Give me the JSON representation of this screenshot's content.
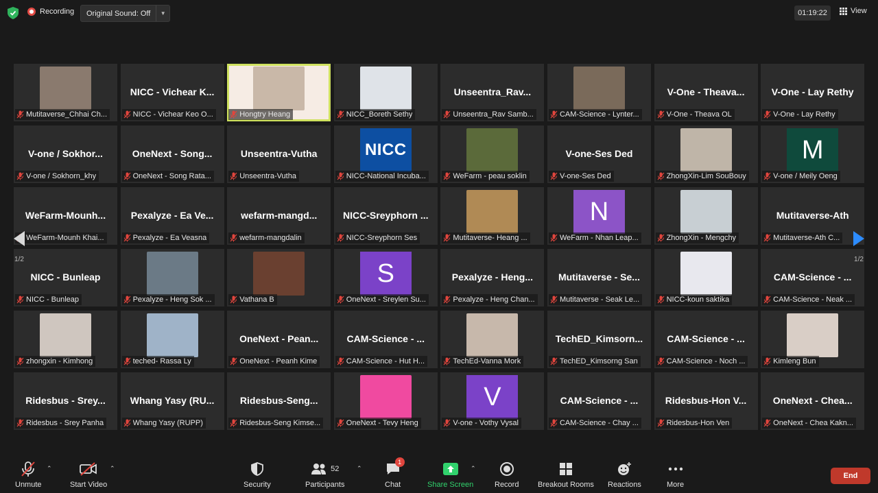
{
  "topbar": {
    "recording_label": "Recording",
    "sound_label": "Original Sound: Off",
    "timer": "01:19:22",
    "view_label": "View"
  },
  "pager": {
    "left": "1/2",
    "right": "1/2"
  },
  "tiles": [
    {
      "type": "photo",
      "bg": "#8a7a6e",
      "label": "Mutitaverse_Chhai Ch..."
    },
    {
      "type": "text",
      "name": "NICC - Vichear K...",
      "label": "NICC - Vichear Keo O..."
    },
    {
      "type": "active",
      "bg": "#c9b8a8",
      "label": "Hongtry Heang"
    },
    {
      "type": "photo",
      "bg": "#dfe3e8",
      "label": "NICC_Boreth Sethy"
    },
    {
      "type": "text",
      "name": "Unseentra_Rav...",
      "label": "Unseentra_Rav Samb..."
    },
    {
      "type": "photo",
      "bg": "#7a6a5a",
      "label": "CAM-Science - Lynter..."
    },
    {
      "type": "text",
      "name": "V-One - Theava...",
      "label": "V-One - Theava OL"
    },
    {
      "type": "text",
      "name": "V-One - Lay Rethy",
      "label": "V-One - Lay Rethy"
    },
    {
      "type": "text",
      "name": "V-one / Sokhor...",
      "label": "V-one / Sokhorn_khy"
    },
    {
      "type": "text",
      "name": "OneNext - Song...",
      "label": "OneNext - Song Rata..."
    },
    {
      "type": "text",
      "name": "Unseentra-Vutha",
      "label": "Unseentra-Vutha"
    },
    {
      "type": "nicc",
      "logo": "NICC",
      "label": "NICC-National Incuba..."
    },
    {
      "type": "photo",
      "bg": "#5b6a3a",
      "label": "WeFarm - peau soklin"
    },
    {
      "type": "text",
      "name": "V-one-Ses Ded",
      "label": "V-one-Ses Ded"
    },
    {
      "type": "photo",
      "bg": "#bfb5a8",
      "label": "ZhongXin-Lim SouBouy"
    },
    {
      "type": "letter",
      "letter": "M",
      "bg": "#0f4a3c",
      "label": "V-one / Meily Oeng"
    },
    {
      "type": "text",
      "name": "WeFarm-Mounh...",
      "label": "WeFarm-Mounh Khai..."
    },
    {
      "type": "text",
      "name": "Pexalyze - Ea Ve...",
      "label": "Pexalyze - Ea Veasna"
    },
    {
      "type": "text",
      "name": "wefarm-mangd...",
      "label": "wefarm-mangdalin"
    },
    {
      "type": "text",
      "name": "NICC-Sreyphorn ...",
      "label": "NICC-Sreyphorn Ses"
    },
    {
      "type": "photo",
      "bg": "#b08a55",
      "label": "Mutitaverse- Heang ..."
    },
    {
      "type": "letter",
      "letter": "N",
      "bg": "#8c54c7",
      "label": "WeFarm - Nhan Leap..."
    },
    {
      "type": "photo",
      "bg": "#c8cfd3",
      "label": "ZhongXin - Mengchy"
    },
    {
      "type": "text",
      "name": "Mutitaverse-Ath",
      "label": "Mutitaverse-Ath C..."
    },
    {
      "type": "text",
      "name": "NICC - Bunleap",
      "label": "NICC - Bunleap"
    },
    {
      "type": "photo",
      "bg": "#6b7a86",
      "label": "Pexalyze - Heng Sok ..."
    },
    {
      "type": "photo",
      "bg": "#6a4030",
      "label": "Vathana B"
    },
    {
      "type": "letter",
      "letter": "S",
      "bg": "#7b42c8",
      "label": "OneNext - Sreylen Su..."
    },
    {
      "type": "text",
      "name": "Pexalyze - Heng...",
      "label": "Pexalyze - Heng Chan..."
    },
    {
      "type": "text",
      "name": "Mutitaverse - Se...",
      "label": "Mutitaverse - Seak Le..."
    },
    {
      "type": "photo",
      "bg": "#e8e8ee",
      "label": "NICC-koun saktika"
    },
    {
      "type": "text",
      "name": "CAM-Science - ...",
      "label": "CAM-Science - Neak ..."
    },
    {
      "type": "photo",
      "bg": "#cfc6bf",
      "label": "zhongxin - Kimhong"
    },
    {
      "type": "photo",
      "bg": "#9fb3c8",
      "label": "teched- Rassa Ly"
    },
    {
      "type": "text",
      "name": "OneNext - Pean...",
      "label": "OneNext - Peanh Kime"
    },
    {
      "type": "text",
      "name": "CAM-Science - ...",
      "label": "CAM-Science - Hut H..."
    },
    {
      "type": "photo",
      "bg": "#c7b8ab",
      "label": "TechEd-Vanna Mork"
    },
    {
      "type": "text",
      "name": "TechED_Kimsorn...",
      "label": "TechED_Kimsorng San"
    },
    {
      "type": "text",
      "name": "CAM-Science - ...",
      "label": "CAM-Science - Noch ..."
    },
    {
      "type": "photo",
      "bg": "#d9cec6",
      "label": "Kimleng Bun"
    },
    {
      "type": "text",
      "name": "Ridesbus - Srey...",
      "label": "Ridesbus - Srey Panha"
    },
    {
      "type": "text",
      "name": "Whang Yasy (RU...",
      "label": "Whang Yasy (RUPP)"
    },
    {
      "type": "text",
      "name": "Ridesbus-Seng...",
      "label": "Ridesbus-Seng Kimse..."
    },
    {
      "type": "photo",
      "bg": "#f04aa0",
      "label": "OneNext - Tevy Heng"
    },
    {
      "type": "letter",
      "letter": "V",
      "bg": "#7b42c8",
      "label": "V-one - Vothy Vysal"
    },
    {
      "type": "text",
      "name": "CAM-Science - ...",
      "label": "CAM-Science - Chay ..."
    },
    {
      "type": "text",
      "name": "Ridesbus-Hon V...",
      "label": "Ridesbus-Hon Ven"
    },
    {
      "type": "text",
      "name": "OneNext - Chea...",
      "label": "OneNext - Chea Kakn..."
    }
  ],
  "toolbar": {
    "unmute": "Unmute",
    "start_video": "Start Video",
    "security": "Security",
    "participants": "Participants",
    "participants_count": "52",
    "chat": "Chat",
    "chat_badge": "1",
    "share_screen": "Share Screen",
    "record": "Record",
    "breakout_rooms": "Breakout Rooms",
    "reactions": "Reactions",
    "more": "More",
    "end": "End"
  },
  "colors": {
    "accent_green": "#31d26d",
    "end_red": "#c0392b",
    "active_border": "#cfe15f"
  }
}
